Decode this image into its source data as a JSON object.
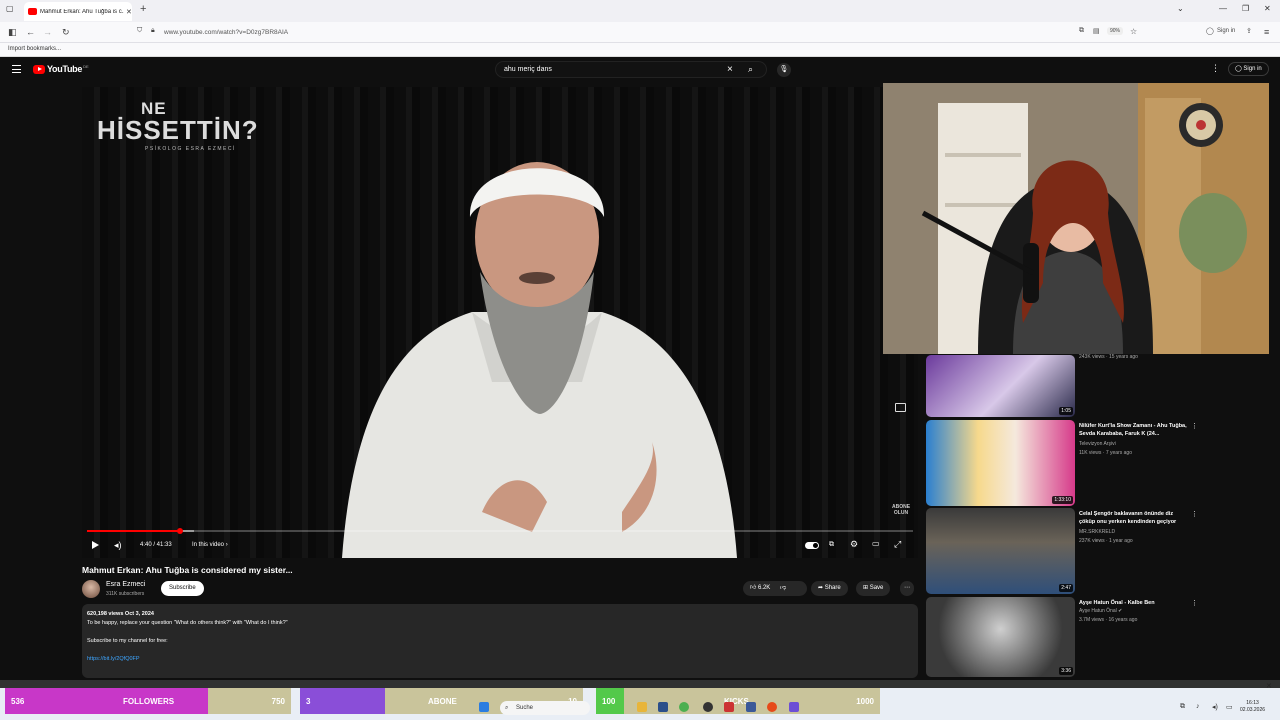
{
  "browser": {
    "tab_title": "Mahmut Erkan: Ahu Tuğba is c...",
    "url": "www.youtube.com/watch?v=D0zg7BR8AIA",
    "zoom": "90%",
    "signin": "Sign in",
    "bookmarks": "Import bookmarks..."
  },
  "youtube": {
    "logo": "YouTube",
    "region": "DE",
    "search_query": "ahu meriç dans",
    "signin": "Sign in"
  },
  "player": {
    "brand_line1": "NE",
    "brand_line2": "HİSSETTİN?",
    "brand_line3": "PSİKOLOG ESRA EZMECİ",
    "time": "4:40 / 41:33",
    "chapters": "In this video",
    "subscribe_watermark": "ABONE OLUN",
    "progress_played": 0.112,
    "progress_loaded": 0.13
  },
  "video": {
    "title": "Mahmut Erkan: Ahu Tuğba is considered my sister...",
    "channel": "Esra Ezmeci",
    "subscribers": "311K subscribers",
    "subscribe": "Subscribe",
    "likes": "6.2K",
    "share": "Share",
    "save": "Save",
    "desc_meta": "620,198 views  Oct 3, 2024",
    "desc_line1": "To be happy, replace your question \"What do others think?\" with \"What do I think?\"",
    "desc_line2": "Subscribe to my channel for free:",
    "desc_link": "https://bit.ly/2QfQ0FP"
  },
  "related": [
    {
      "title": "",
      "channel": "",
      "meta": "243K views · 15 years ago",
      "duration": "1:05"
    },
    {
      "title": "Nilüfer Kurt'la Show Zamanı - Ahu Tuğba, Sevda Karababa, Faruk K (24...",
      "channel": "Televizyon Arşivi",
      "meta": "11K views · 7 years ago",
      "duration": "1:33:10"
    },
    {
      "title": "Celal Şengör baklavanın önünde diz çöküp onu yerken kendinden geçiyor",
      "channel": "MR.SRKKRELD",
      "meta": "237K views · 1 year ago",
      "duration": "2:47"
    },
    {
      "title": "Ayşe Hatun Önal - Kalbe Ben",
      "channel": "Ayşe Hatun Önal ✔",
      "meta": "3.7M views · 16 years ago",
      "duration": "3:36"
    }
  ],
  "overlay": {
    "followers": {
      "label": "FOLLOWERS",
      "current": "536",
      "goal": "750",
      "fraction": 0.71,
      "color": "#c837c8"
    },
    "abone": {
      "label": "ABONE",
      "current": "3",
      "goal": "10",
      "fraction": 0.3,
      "color": "#8a4ed8"
    },
    "kicks": {
      "label": "KICKS",
      "current": "100",
      "goal": "1000",
      "fraction": 0.1,
      "color": "#53c94a"
    },
    "taskbar_search": "Suche",
    "time": "16:13",
    "date": "02.03.2026"
  }
}
